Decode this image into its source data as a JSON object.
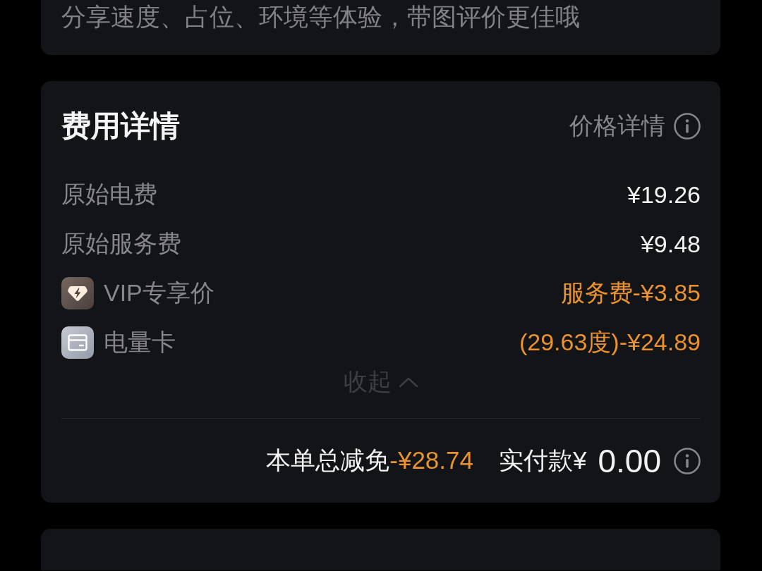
{
  "review_card": {
    "hint": "分享速度、占位、环境等体验，带图评价更佳哦"
  },
  "fee_card": {
    "title": "费用详情",
    "price_details_link": "价格详情",
    "rows": [
      {
        "kind": "charge",
        "label": "原始电费",
        "value": "¥19.26"
      },
      {
        "kind": "charge",
        "label": "原始服务费",
        "value": "¥9.48"
      },
      {
        "kind": "vip",
        "label": "VIP专享价",
        "value": "服务费-¥3.85"
      },
      {
        "kind": "card",
        "label": "电量卡",
        "value": "(29.63度)-¥24.89"
      }
    ],
    "collapse": {
      "label": "收起",
      "expanded": true
    },
    "total": {
      "discount_label": "本单总减免",
      "discount_amount": "-¥28.74",
      "paid_label": "实付款¥",
      "paid_amount": "0.00"
    }
  }
}
